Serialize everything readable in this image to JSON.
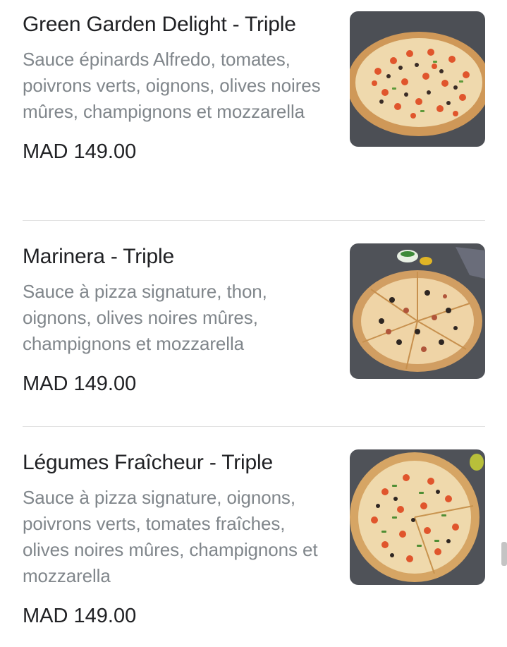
{
  "menu": {
    "items": [
      {
        "title": "Green Garden Delight - Triple",
        "description": "Sauce épinards Alfredo, tomates, poivrons verts, oignons, olives noires mûres, champignons et mozzarella",
        "price": "MAD 149.00"
      },
      {
        "title": "Marinera - Triple",
        "description": "Sauce à pizza signature, thon, oignons, olives noires mûres, champignons et mozzarella",
        "price": "MAD 149.00"
      },
      {
        "title": "Légumes Fraîcheur - Triple",
        "description": "Sauce à pizza signature, oignons, poivrons verts, tomates fraîches, olives noires mûres, champignons et mozzarella",
        "price": "MAD 149.00"
      }
    ]
  },
  "photo_background": "#4f5258",
  "crust_color": "#d9a566",
  "cheese_color": "#f1dfb8"
}
